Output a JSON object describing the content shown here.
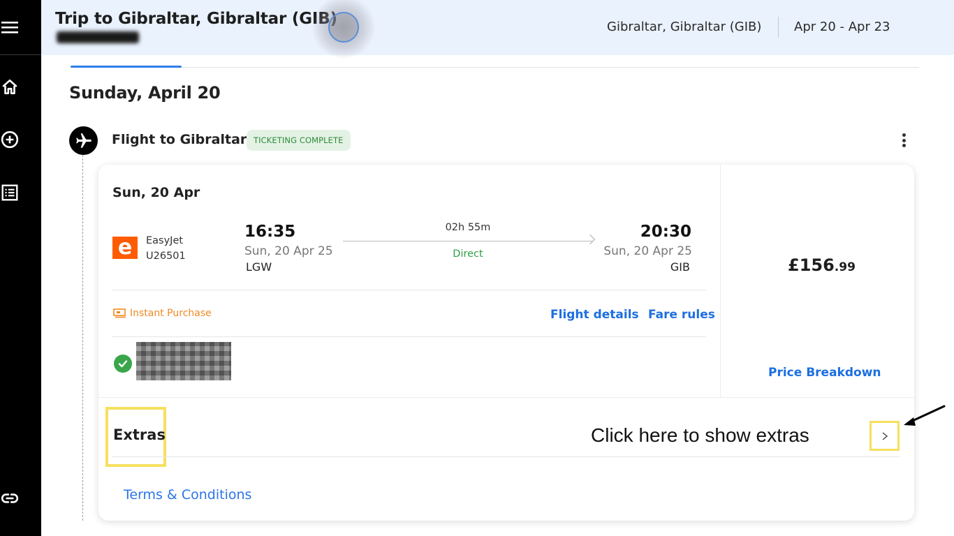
{
  "header": {
    "trip_title": "Trip to Gibraltar, Gibraltar (GIB)",
    "destination": "Gibraltar, Gibraltar (GIB)",
    "dates": "Apr 20 - Apr 23"
  },
  "day": {
    "heading": "Sunday, April 20"
  },
  "flight": {
    "title": "Flight to Gibraltar",
    "status": "TICKETING COMPLETE",
    "segment_date": "Sun, 20 Apr",
    "airline_name": "EasyJet",
    "airline_logo_letter": "e",
    "flight_number": "U26501",
    "departure": {
      "time": "16:35",
      "date": "Sun, 20 Apr 25",
      "airport": "LGW"
    },
    "duration": "02h 55m",
    "stops": "Direct",
    "arrival": {
      "time": "20:30",
      "date": "Sun, 20 Apr 25",
      "airport": "GIB"
    },
    "price_main": "£156",
    "price_cents": ".99",
    "instant_purchase": "Instant Purchase",
    "links": {
      "flight_details": "Flight details",
      "fare_rules": "Fare rules",
      "price_breakdown": "Price Breakdown"
    },
    "extras_label": "Extras",
    "terms": "Terms & Conditions"
  },
  "annotation": {
    "text": "Click here to show extras"
  },
  "colors": {
    "accent": "#1c6fe0",
    "header_bg": "#eaf2fd",
    "status_green": "#2e8b3a",
    "instant_orange": "#f08a24",
    "highlight_yellow": "#f6e05e",
    "easyjet_orange": "#ff5b00"
  },
  "icons": {
    "rail": [
      "menu-icon",
      "home-icon",
      "add-circle-icon",
      "list-icon",
      "link-icon"
    ],
    "plane": "airplane-icon",
    "kebab": "more-vertical-icon",
    "chevron": "chevron-right-icon"
  }
}
